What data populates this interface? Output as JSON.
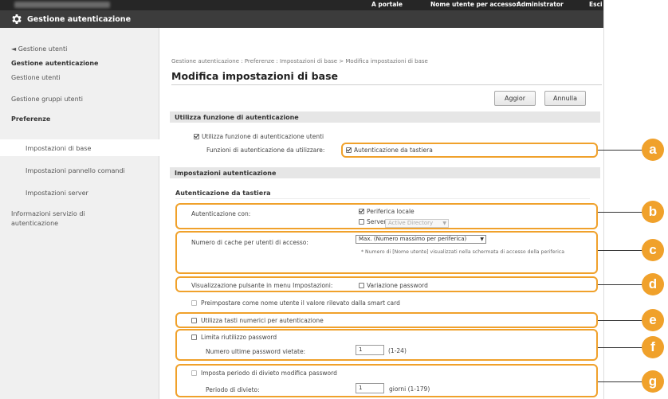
{
  "topbar": {
    "portal_link": "A portale",
    "login_user_label": "Nome utente per accesso:",
    "login_user_value": "Administrator",
    "logout_link": "Esci"
  },
  "window": {
    "title": "Gestione autenticazione"
  },
  "sidebar": {
    "items": [
      {
        "label": "◄ Gestione utenti"
      },
      {
        "label": "Gestione autenticazione"
      },
      {
        "label": "Gestione utenti"
      },
      {
        "label": "Gestione gruppi utenti"
      },
      {
        "label": "Preferenze"
      },
      {
        "label": "Impostazioni di base"
      },
      {
        "label": "Impostazioni pannello comandi"
      },
      {
        "label": "Impostazioni server"
      },
      {
        "label": "Informazioni servizio di"
      },
      {
        "label": "autenticazione"
      }
    ]
  },
  "main": {
    "breadcrumb": "Gestione autenticazione : Preferenze : Impostazioni di base > Modifica impostazioni di base",
    "title": "Modifica impostazioni di base",
    "update_button": "Aggior",
    "cancel_button": "Annulla",
    "sections": {
      "use_auth": {
        "header": "Utilizza funzione di autenticazione",
        "enable_label": "Utilizza funzione di autenticazione utenti",
        "functions_label": "Funzioni di autenticazione da utilizzare:",
        "keyboard_auth": "Autenticazione da tastiera"
      },
      "auth_settings": {
        "header": "Impostazioni autenticazione",
        "sub_header": "Autenticazione da tastiera",
        "auth_with_label": "Autenticazione con:",
        "local_device": "Periferica locale",
        "server": "Server",
        "server_select": "Active Directory",
        "cache_label": "Numero di cache per utenti di accesso:",
        "cache_select": "Max. (Numero massimo per periferica)",
        "cache_note": "* Numero di [Nome utente] visualizzati nella schermata di accesso della periferica",
        "settings_button_label": "Visualizzazione pulsante in menu Impostazioni:",
        "change_password": "Variazione password",
        "smartcard_default": "Preimpostare come nome utente il valore rilevato dalla smart card",
        "numeric_keys": "Utilizza tasti numerici per autenticazione",
        "limit_reuse": "Limita riutilizzo password",
        "last_passwords_label": "Numero ultime password vietate:",
        "last_passwords_value": "1",
        "last_passwords_range": "(1-24)",
        "prohibit_period": "Imposta periodo di divieto modifica password",
        "prohibit_label": "Periodo di divieto:",
        "prohibit_value": "1",
        "prohibit_range": "giorni (1-179)"
      }
    }
  },
  "callouts": [
    "a",
    "b",
    "c",
    "d",
    "e",
    "f",
    "g"
  ],
  "colors": {
    "accent": "#f0a12b",
    "titlebar": "#3c3c3c",
    "topbar": "#262626"
  }
}
